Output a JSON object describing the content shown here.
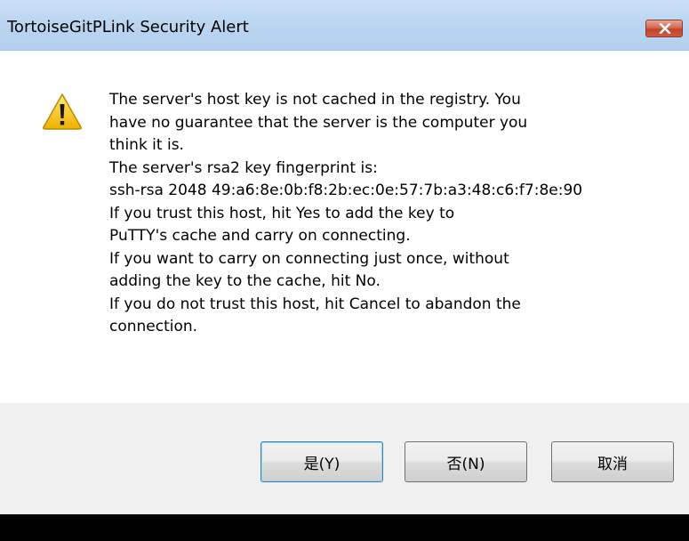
{
  "window": {
    "title": "TortoiseGitPLink Security Alert",
    "close_icon": "close-icon"
  },
  "alert": {
    "icon": "warning-icon",
    "lines": [
      "The server's host key is not cached in the registry. You",
      "have no guarantee that the server is the computer you",
      "think it is.",
      "The server's rsa2 key fingerprint is:",
      "ssh-rsa 2048 49:a6:8e:0b:f8:2b:ec:0e:57:7b:a3:48:c6:f7:8e:90",
      "If you trust this host, hit Yes to add the key to",
      "PuTTY's cache and carry on connecting.",
      "If you want to carry on connecting just once, without",
      "adding the key to the cache, hit No.",
      "If you do not trust this host, hit Cancel to abandon the",
      "connection."
    ]
  },
  "buttons": {
    "yes_label": "是(Y)",
    "no_label": "否(N)",
    "cancel_label": "取消"
  },
  "colors": {
    "warning_yellow": "#f5c518",
    "close_red": "#c2432b",
    "default_button_border": "#3c7fb1"
  }
}
